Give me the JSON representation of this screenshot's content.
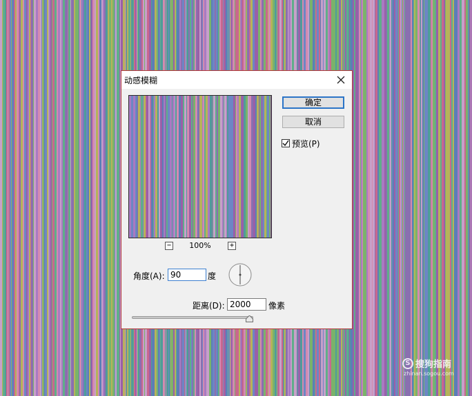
{
  "dialog": {
    "title": "动感模糊",
    "ok_label": "确定",
    "cancel_label": "取消",
    "preview_label": "预览(P)",
    "preview_checked": true,
    "zoom_level": "100%",
    "zoom_out_symbol": "−",
    "zoom_in_symbol": "+",
    "angle_label": "角度(A):",
    "angle_value": "90",
    "angle_unit": "度",
    "distance_label": "距离(D):",
    "distance_value": "2000",
    "distance_unit": "像素",
    "distance_slider_fraction": 0.98,
    "icons": {
      "close": "close-icon",
      "checkmark": "checkmark-icon",
      "zoom_out": "zoom-out-icon",
      "zoom_in": "zoom-in-icon",
      "angle_dial": "angle-dial-icon",
      "slider_thumb": "slider-thumb-icon"
    }
  },
  "watermark": {
    "logo_text": "搜狗指南",
    "logo_symbol": "S",
    "url": "zhinan.sogou.com"
  },
  "colors": {
    "stripe_palette": [
      "#8a6fb0",
      "#5fae8a",
      "#c9678e",
      "#6d86c4",
      "#b6b35a",
      "#9a5fa8",
      "#4f9c9a",
      "#d48ab0",
      "#7ab36a",
      "#a97ac2",
      "#5b7fb7",
      "#c7a0c9"
    ],
    "accent": "#2b74c7",
    "dialog_border": "#b03a3a"
  }
}
